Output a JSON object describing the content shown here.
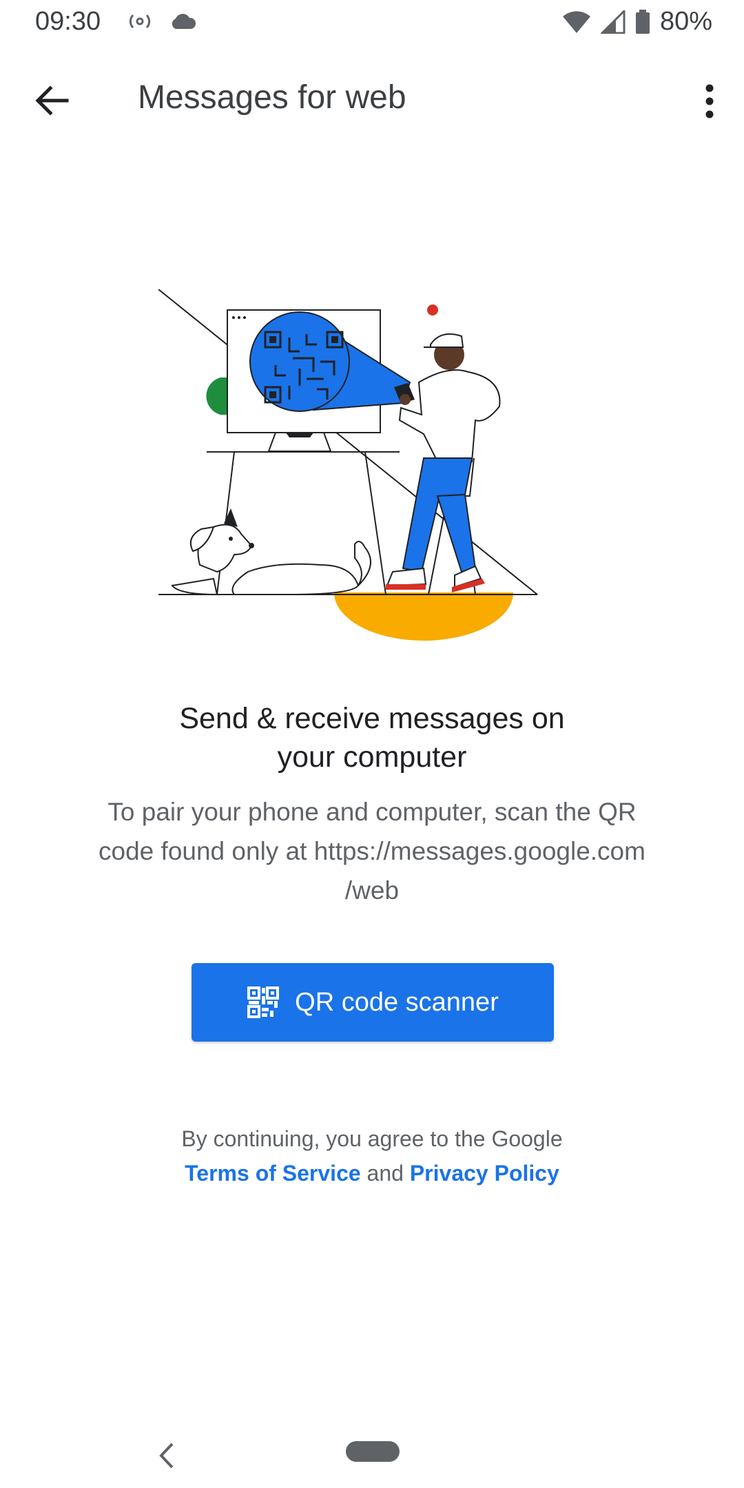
{
  "status_bar": {
    "time": "09:30",
    "battery": "80%",
    "icons": [
      "hotspot-icon",
      "cloud-icon",
      "wifi-icon",
      "signal-icon",
      "battery-icon"
    ]
  },
  "app_bar": {
    "title": "Messages for web",
    "back_icon": "arrow-back-icon",
    "more_icon": "more-vert-icon"
  },
  "content": {
    "headline_line1": "Send & receive messages on",
    "headline_line2": "your computer",
    "description_line1": "To pair your phone and computer, scan the QR",
    "description_line2": "code found only at https://messages.google.com",
    "description_line3": "/web",
    "qr_button_label": "QR code scanner",
    "qr_button_icon": "qr-code-icon"
  },
  "legal": {
    "prefix": "By continuing, you agree to the Google",
    "terms_link": "Terms of Service",
    "conjunction": "and",
    "privacy_link": "Privacy Policy"
  },
  "colors": {
    "accent": "#1a73e8",
    "illustration_blue": "#1a73e8",
    "illustration_green": "#1e8e3e",
    "illustration_yellow": "#f9ab00",
    "illustration_red": "#d93025"
  }
}
